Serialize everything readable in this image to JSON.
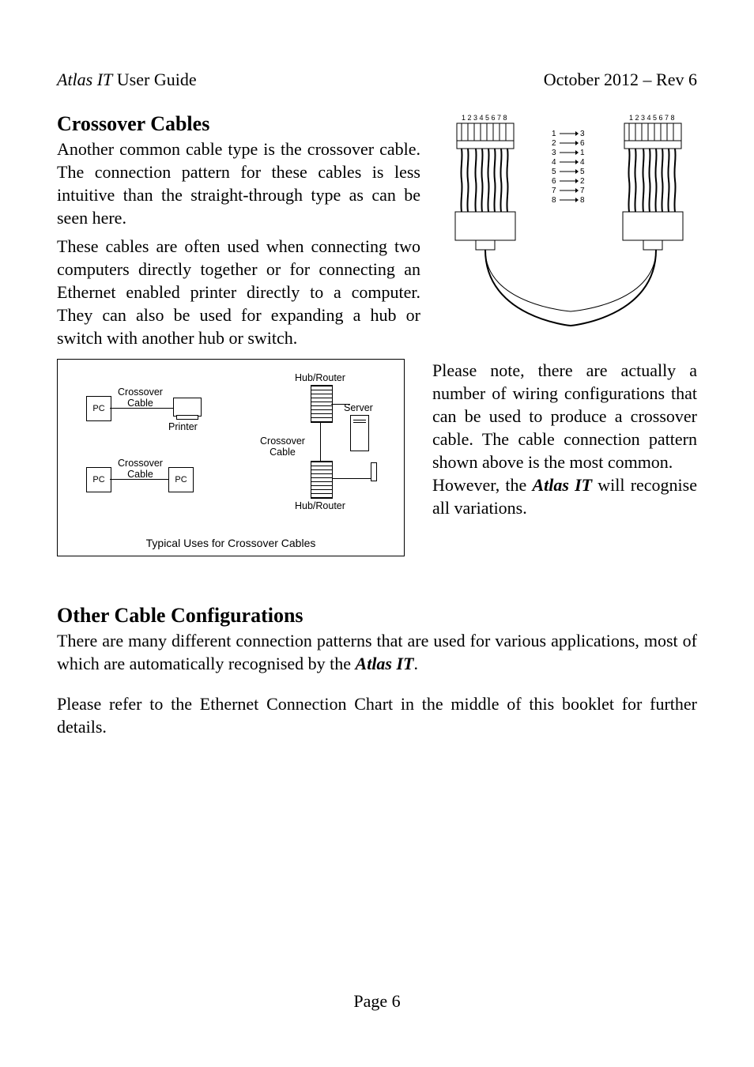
{
  "header": {
    "product": "Atlas IT",
    "doc": " User Guide",
    "right": "October 2012 – Rev 6"
  },
  "section1": {
    "heading": "Crossover Cables",
    "p1": "Another common cable type is the crossover cable. The connection pattern for these cables is less intuitive than the straight-through type as can be seen here.",
    "p2": "These cables are often used when connecting two computers directly together or for connecting an Ethernet enabled printer directly to a computer. They can also be used for expanding a hub or switch with another hub or switch."
  },
  "wiring": {
    "pinsLeft": "1 2 3 4 5 6 7 8",
    "pinsRight": "1 2 3 4 5 6 7 8",
    "map": [
      {
        "l": "1",
        "r": "3"
      },
      {
        "l": "2",
        "r": "6"
      },
      {
        "l": "3",
        "r": "1"
      },
      {
        "l": "4",
        "r": "4"
      },
      {
        "l": "5",
        "r": "5"
      },
      {
        "l": "6",
        "r": "2"
      },
      {
        "l": "7",
        "r": "7"
      },
      {
        "l": "8",
        "r": "8"
      }
    ]
  },
  "diagram": {
    "caption": "Typical Uses for Crossover Cables",
    "labels": {
      "pc": "PC",
      "crossover": "Crossover\nCable",
      "printer": "Printer",
      "hubrouter": "Hub/Router",
      "server": "Server"
    }
  },
  "section1b": {
    "p3a": "Please note, there are actually a number of wiring configurations that can be used to produce a crossover cable. The cable connection pattern shown above is the most common.",
    "p3b_pre": "However, the ",
    "p3b_em": "Atlas IT",
    "p3b_post": " will recognise all variations."
  },
  "section2": {
    "heading": "Other Cable Configurations",
    "p1_pre": "There are many different connection patterns that are used for various applications, most of which are automatically recognised by the ",
    "p1_em": "Atlas IT",
    "p1_post": ".",
    "p2": "Please refer to the Ethernet Connection Chart in the middle of this booklet for further details."
  },
  "footer": "Page 6"
}
